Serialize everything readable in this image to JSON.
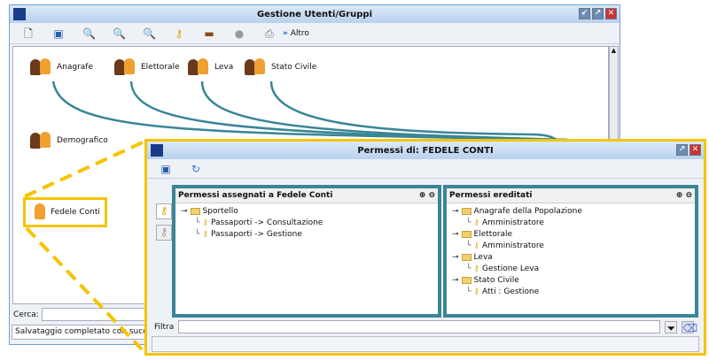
{
  "main": {
    "title": "Gestione Utenti/Gruppi",
    "toolbar": {
      "more_label": "Altro"
    },
    "groups": [
      "Anagrafe",
      "Elettorale",
      "Leva",
      "Stato Civile",
      "Demografico"
    ],
    "user": "Fedele Conti",
    "search_label": "Cerca:",
    "search_value": "",
    "status": "Salvataggio completato con successo"
  },
  "dialog": {
    "title": "Permessi di: FEDELE CONTI",
    "assigned": {
      "header": "Permessi assegnati a Fedele Conti",
      "tree": [
        {
          "folder": "Sportello",
          "items": [
            "Passaporti -> Consultazione",
            "Passaporti -> Gestione"
          ]
        }
      ]
    },
    "inherited": {
      "header": "Permessi ereditati",
      "tree": [
        {
          "folder": "Anagrafe della Popolazione",
          "items": [
            "Amministratore"
          ]
        },
        {
          "folder": "Elettorale",
          "items": [
            "Amministratore"
          ]
        },
        {
          "folder": "Leva",
          "items": [
            "Gestione Leva"
          ]
        },
        {
          "folder": "Stato Civile",
          "items": [
            "Atti : Gestione"
          ]
        }
      ]
    },
    "filter_label": "Filtra",
    "filter_value": ""
  },
  "colors": {
    "highlight": "#f5c400",
    "arrow": "#3a8596"
  }
}
